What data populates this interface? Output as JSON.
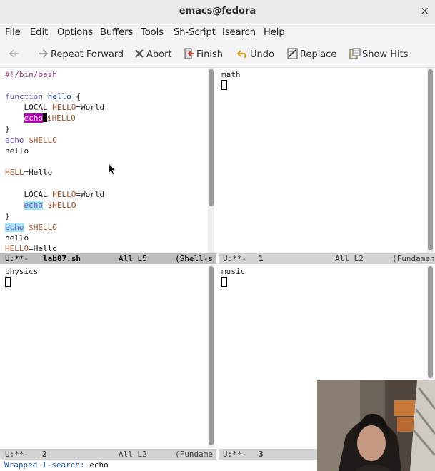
{
  "window": {
    "title": "emacs@fedora",
    "close_glyph": "×"
  },
  "menu": [
    "File",
    "Edit",
    "Options",
    "Buffers",
    "Tools",
    "Sh-Script",
    "Isearch",
    "Help"
  ],
  "toolbar": {
    "back_icon": "back-arrow-icon",
    "repeat_forward": "Repeat Forward",
    "abort": "Abort",
    "finish": "Finish",
    "undo": "Undo",
    "replace": "Replace",
    "show_hits": "Show Hits"
  },
  "colors": {
    "isearch_current": "#b000b0",
    "isearch_other": "#a6e3f2",
    "keyword": "#6f5bd3",
    "variable": "#a0522d"
  },
  "code_window": {
    "line1": "#!/bin/bash",
    "l3_kw": "function",
    "l3_fn": "hello",
    "l3_rest": " {",
    "l4_a": "    LOCAL ",
    "l4_var": "HELLO",
    "l4_b": "=World",
    "l5_indent": "    ",
    "l5_match": "echo",
    "l5_var": "$HELLO",
    "l6": "}",
    "l7_kw": "echo",
    "l7_var": "$HELLO",
    "l8": "hello",
    "l10_var": "HELL",
    "l10_b": "=Hello",
    "l12_a": "    LOCAL ",
    "l12_var": "HELLO",
    "l12_b": "=World",
    "l13_indent": "    ",
    "l13_match": "echo",
    "l13_var": "$HELLO",
    "l14": "}",
    "l15_match": "echo",
    "l15_var": "$HELLO",
    "l16": "hello",
    "l17_var": "HELLO",
    "l17_b": "=Hello"
  },
  "modelines": {
    "code": {
      "status": "U:**-",
      "buffer": "lab07.sh",
      "pos": "All L5",
      "mode": "(Shell-s"
    },
    "math": {
      "status": "U:**-",
      "buffer": "1",
      "pos": "All L2",
      "mode": "(Fundamen"
    },
    "physics": {
      "status": "U:**-",
      "buffer": "2",
      "pos": "All L2",
      "mode": "(Fundame"
    },
    "music": {
      "status": "U:**-",
      "buffer": "3"
    }
  },
  "buffers": {
    "math": "math",
    "physics": "physics",
    "music": "music"
  },
  "echo_area": {
    "prompt": "Wrapped I-search:",
    "value": "echo"
  }
}
